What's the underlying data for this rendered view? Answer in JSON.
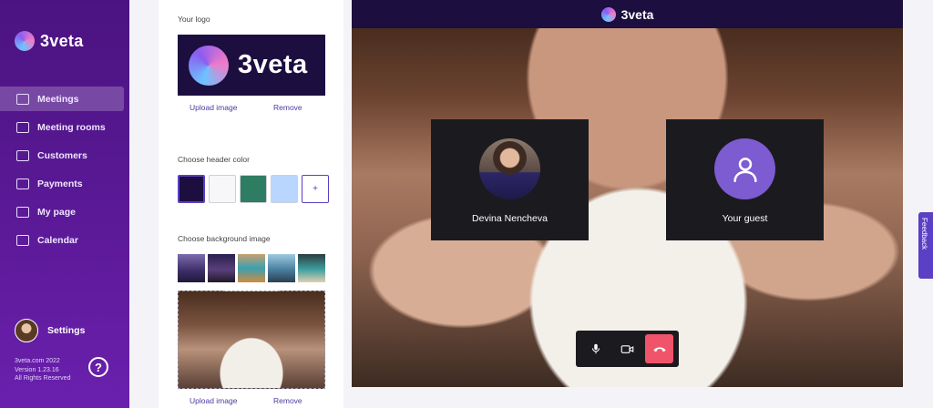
{
  "brand": {
    "name": "3veta"
  },
  "nav": [
    {
      "label": "Meetings",
      "active": true
    },
    {
      "label": "Meeting rooms"
    },
    {
      "label": "Customers"
    },
    {
      "label": "Payments"
    },
    {
      "label": "My page"
    },
    {
      "label": "Calendar"
    }
  ],
  "settings": {
    "label": "Settings"
  },
  "footer": {
    "line1": "3veta.com 2022",
    "line2": "Version 1.23.16",
    "line3": "All Rights Reserved",
    "help": "?"
  },
  "panel": {
    "logo_label": "Your logo",
    "logo_text": "3veta",
    "upload_label": "Upload image",
    "remove_label": "Remove",
    "header_color_label": "Choose header color",
    "header_colors": [
      "#1c0e3f",
      "#f7f7f9",
      "#2e7d62",
      "#b9d6ff"
    ],
    "add_color": "+",
    "background_label": "Choose background image"
  },
  "meeting": {
    "header_text": "3veta",
    "host_name": "Devina Nencheva",
    "guest_name": "Your guest"
  },
  "feedback": {
    "label": "Feedback"
  }
}
